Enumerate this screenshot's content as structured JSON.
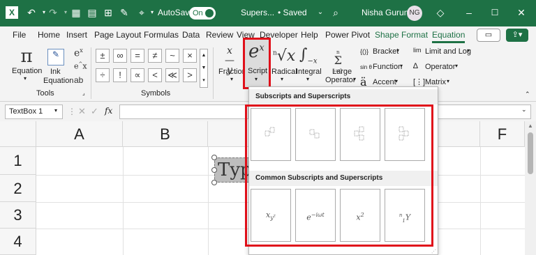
{
  "titlebar": {
    "autosave_label": "AutoSave",
    "toggle": "On",
    "file_title": "Supers...",
    "saved": "• Saved",
    "user_name": "Nisha Gurung",
    "initials": "NG"
  },
  "menu": {
    "tabs": [
      "File",
      "Home",
      "Insert",
      "Page Layout",
      "Formulas",
      "Data",
      "Review",
      "View",
      "Developer",
      "Help",
      "Power Pivot",
      "Shape Format",
      "Equation"
    ],
    "active": "Equation"
  },
  "ribbon": {
    "equation": "Equation",
    "ink_equation": [
      "Ink",
      "Equation"
    ],
    "tools_group": "Tools",
    "symbols_group": "Symbols",
    "symbols": [
      "±",
      "∞",
      "=",
      "≠",
      "~",
      "×",
      "÷",
      "!",
      "∝",
      "<",
      "≪",
      ">"
    ],
    "fraction": "Fraction",
    "script": "Script",
    "radical": "Radical",
    "integral": "Integral",
    "large_operator": [
      "Large",
      "Operator"
    ],
    "bracket": "Bracket",
    "function": "Function",
    "accent": "Accent",
    "limit_log": "Limit and Log",
    "operator": "Operator",
    "matrix": "Matrix"
  },
  "formula_bar": {
    "name_box": "TextBox 1",
    "fx": "fx"
  },
  "sheet": {
    "columns": [
      "A",
      "B",
      "F"
    ],
    "rows": [
      "1",
      "2",
      "3",
      "4"
    ],
    "textbox_text": "Typ"
  },
  "dropdown": {
    "section1": "Subscripts and Superscripts",
    "section2": "Common Subscripts and Superscripts",
    "common_tiles": [
      "x_{y^z}",
      "e^{-iωt}",
      "x^2",
      "ⁿ₁Y"
    ]
  },
  "accent_color": "#1e7145",
  "highlight_color": "#e0101a"
}
